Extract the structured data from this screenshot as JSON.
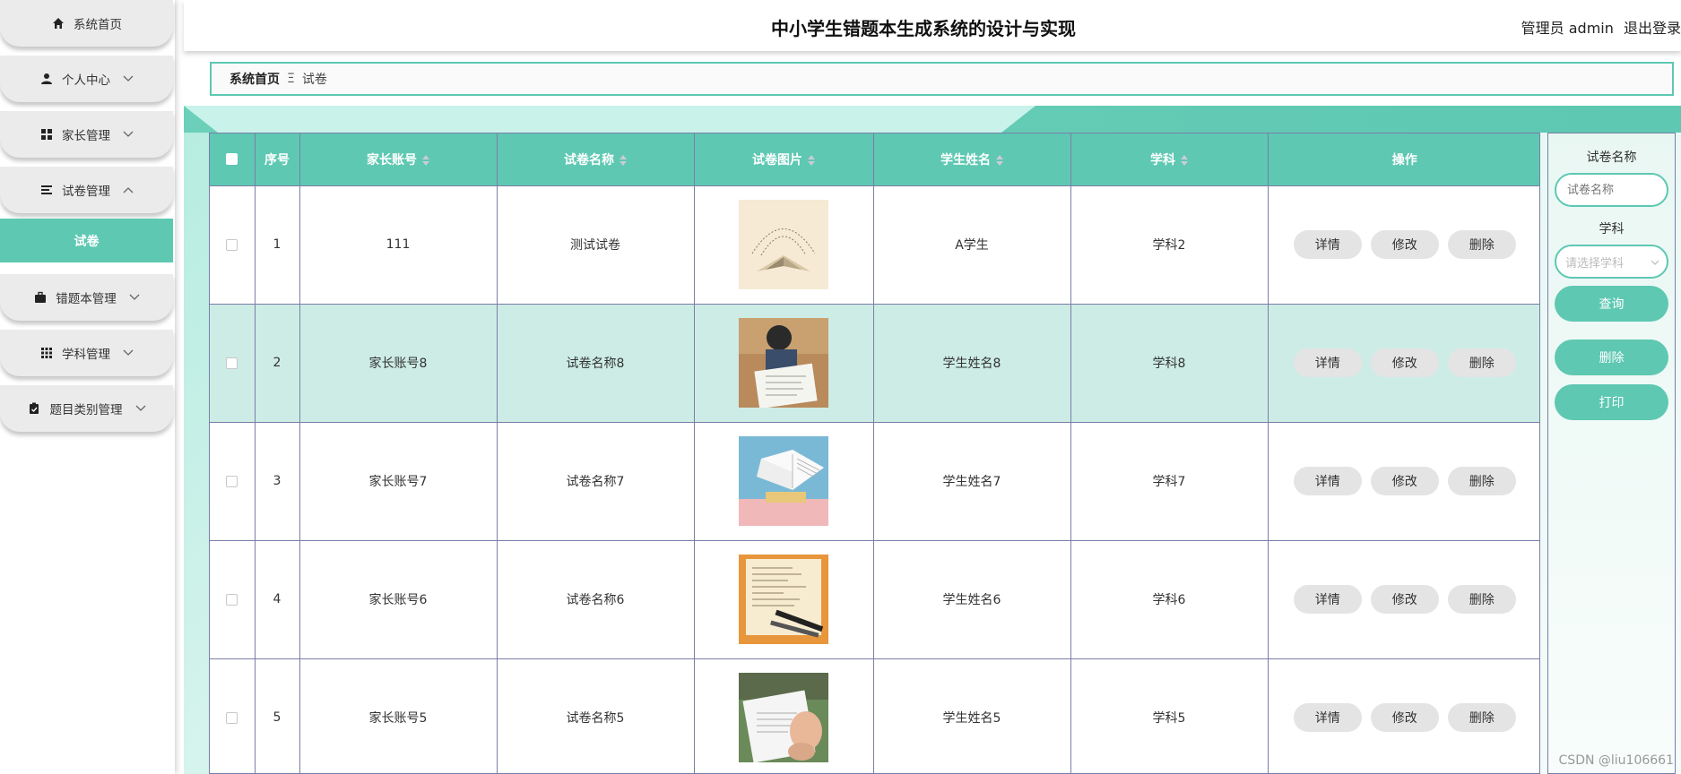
{
  "app": {
    "title": "中小学生错题本生成系统的设计与实现",
    "user_label": "管理员 admin",
    "logout": "退出登录"
  },
  "sidebar": {
    "items": [
      {
        "label": "系统首页",
        "icon": "home-icon"
      },
      {
        "label": "个人中心",
        "icon": "person-icon"
      },
      {
        "label": "家长管理",
        "icon": "grid-icon"
      },
      {
        "label": "试卷管理",
        "icon": "list-icon"
      },
      {
        "label": "错题本管理",
        "icon": "briefcase-icon"
      },
      {
        "label": "学科管理",
        "icon": "apps-icon"
      },
      {
        "label": "题目类别管理",
        "icon": "clipboard-icon"
      }
    ],
    "submenu_label": "试卷"
  },
  "breadcrumb": {
    "home": "系统首页",
    "separator": "Ξ",
    "current": "试卷"
  },
  "table": {
    "headers": {
      "index": "序号",
      "account": "家长账号",
      "name": "试卷名称",
      "image": "试卷图片",
      "student": "学生姓名",
      "subject": "学科",
      "ops": "操作"
    },
    "rows": [
      {
        "index": "1",
        "account": "111",
        "name": "测试试卷",
        "student": "A学生",
        "subject": "学科2"
      },
      {
        "index": "2",
        "account": "家长账号8",
        "name": "试卷名称8",
        "student": "学生姓名8",
        "subject": "学科8"
      },
      {
        "index": "3",
        "account": "家长账号7",
        "name": "试卷名称7",
        "student": "学生姓名7",
        "subject": "学科7"
      },
      {
        "index": "4",
        "account": "家长账号6",
        "name": "试卷名称6",
        "student": "学生姓名6",
        "subject": "学科6"
      },
      {
        "index": "5",
        "account": "家长账号5",
        "name": "试卷名称5",
        "student": "学生姓名5",
        "subject": "学科5"
      }
    ],
    "actions": {
      "detail": "详情",
      "edit": "修改",
      "delete": "删除"
    }
  },
  "search": {
    "name_label": "试卷名称",
    "name_placeholder": "试卷名称",
    "subject_label": "学科",
    "subject_placeholder": "请选择学科",
    "query_btn": "查询",
    "delete_btn": "删除",
    "print_btn": "打印"
  },
  "watermark": "CSDN @liu106661",
  "colors": {
    "accent": "#5ec8b2",
    "highlight_row": "#cdece5",
    "border": "#7a7ea8"
  }
}
